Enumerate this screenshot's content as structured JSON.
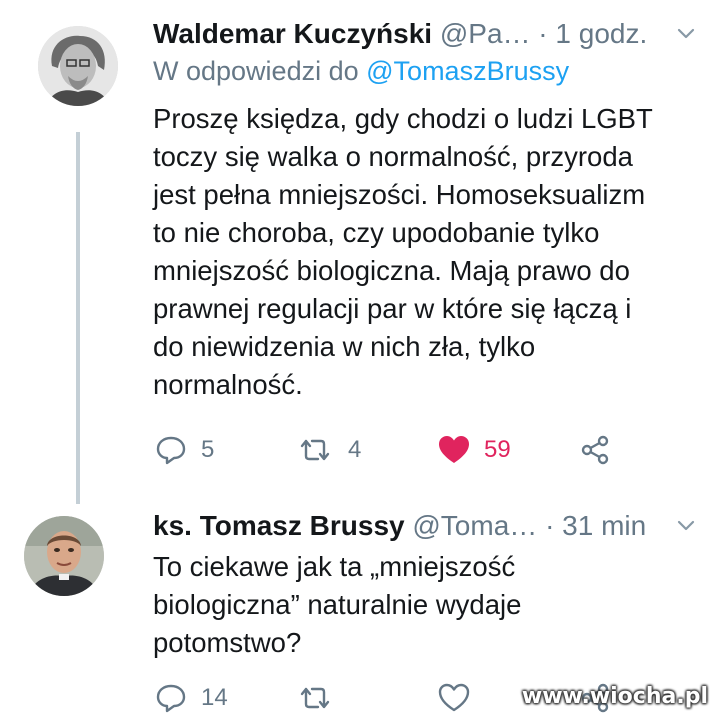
{
  "tweets": [
    {
      "author": "Waldemar Kuczyński",
      "handle": "@Pa…",
      "separator": "·",
      "time": "1 godz.",
      "reply_prefix": "W odpowiedzi do",
      "reply_mention": "@TomaszBrussy",
      "lines": [
        "Proszę księdza, gdy chodzi o ludzi LGBT",
        "toczy się walka o normalność, przyroda",
        "jest pełna mniejszości. Homoseksualizm",
        "to nie choroba, czy upodobanie tylko",
        "mniejszość biologiczna. Mają prawo do",
        "prawnej regulacji par w które się łączą i",
        "do niewidzenia w nich zła, tylko",
        "normalność."
      ],
      "replies": "5",
      "retweets": "4",
      "likes": "59",
      "liked": true
    },
    {
      "author": "ks. Tomasz Brussy",
      "handle": "@Toma…",
      "separator": "·",
      "time": "31 min",
      "lines": [
        "To ciekawe jak ta „mniejszość",
        "biologiczna” naturalnie wydaje",
        "potomstwo?"
      ],
      "replies": "14",
      "retweets": "",
      "likes": "",
      "liked": false
    }
  ],
  "watermark": "www.wiocha.pl",
  "colors": {
    "text": "#14171a",
    "secondary": "#657786",
    "link": "#1da1f2",
    "like": "#e0245e",
    "thread_line": "#c4cfd6"
  }
}
